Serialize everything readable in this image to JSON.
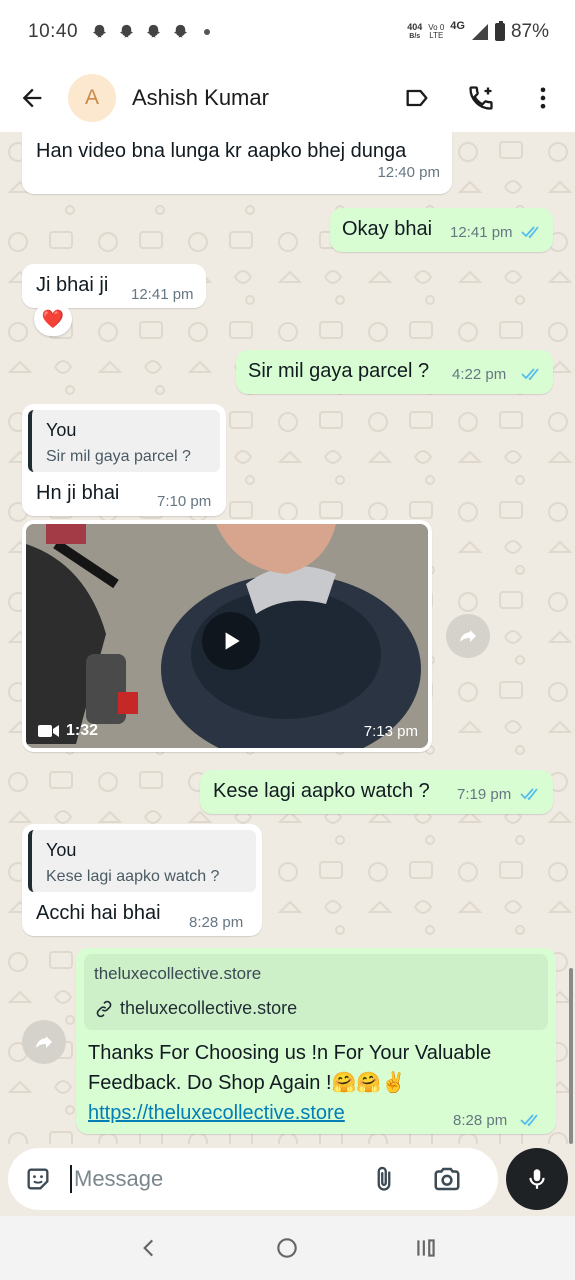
{
  "status_bar": {
    "time": "10:40",
    "net_speed_value": "404",
    "net_speed_unit": "B/s",
    "volte_top": "Vo 0",
    "volte_bottom": "LTE",
    "network_type": "4G",
    "battery_percent": "87%"
  },
  "header": {
    "avatar_letter": "A",
    "contact_name": "Ashish Kumar"
  },
  "messages": [
    {
      "text": "Han video bna lunga kr aapko bhej dunga",
      "time": "12:40 pm"
    },
    {
      "text": "Okay bhai",
      "time": "12:41 pm"
    },
    {
      "text": "Ji bhai ji",
      "time": "12:41 pm",
      "reaction": "❤️"
    },
    {
      "text": "Sir mil gaya parcel ?",
      "time": "4:22 pm"
    },
    {
      "quote_author": "You",
      "quote_text": "Sir mil gaya parcel ?",
      "text": "Hn ji bhai",
      "time": "7:10 pm"
    },
    {
      "video_duration": "1:32",
      "time": "7:13 pm"
    },
    {
      "text": "Kese lagi aapko watch ?",
      "time": "7:19 pm"
    },
    {
      "quote_author": "You",
      "quote_text": "Kese lagi aapko watch ?",
      "text": "Acchi hai bhai",
      "time": "8:28 pm"
    },
    {
      "preview_title": "theluxecollective.store",
      "preview_url": "theluxecollective.store",
      "line1": "Thanks For Choosing us !n For Your Valuable",
      "line2": "Feedback. Do Shop Again !🤗🤗✌️",
      "link": "https://theluxecollective.store",
      "time": "8:28 pm"
    }
  ],
  "composer": {
    "placeholder": "Message"
  },
  "colors": {
    "outgoing_bubble": "#d9fdd3",
    "incoming_bubble": "#ffffff",
    "chat_background": "#efeae2",
    "read_ticks": "#53bdeb",
    "link": "#027eb5"
  },
  "icons": [
    "back-arrow-icon",
    "label-icon",
    "add-call-icon",
    "more-vert-icon",
    "forward-icon",
    "play-icon",
    "video-camera-icon",
    "link-icon",
    "sticker-icon",
    "attach-icon",
    "camera-icon",
    "mic-icon",
    "nav-back-icon",
    "nav-home-icon",
    "nav-recents-icon"
  ]
}
